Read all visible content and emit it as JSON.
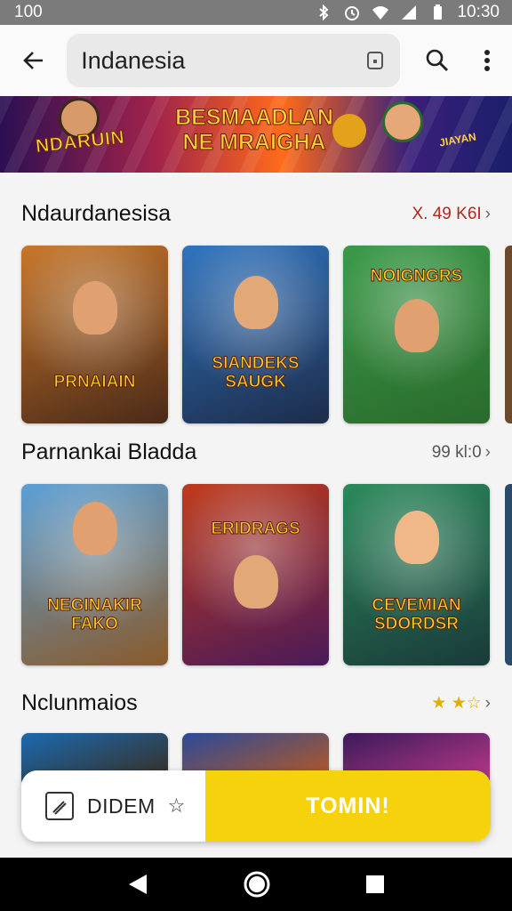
{
  "status_bar": {
    "time_left": "100",
    "time_right": "10:30"
  },
  "app_bar": {
    "search_value": "Indanesia"
  },
  "banner": {
    "left_title": "NDARUIN",
    "center_title": "BESMAADLAN NE MRAIGHA",
    "right_title": "JIAYAN"
  },
  "sections": [
    {
      "title": "Ndaurdanesisa",
      "meta": "X. 49 K6I",
      "meta_color": "#b3261e",
      "cards": [
        {
          "title": "PRNAIAIN",
          "colors": [
            "#c8772a",
            "#4a2a18"
          ]
        },
        {
          "title": "SIANDEKS SAUGK",
          "colors": [
            "#2f74c0",
            "#1d2c4a"
          ]
        },
        {
          "title": "NOIGNGRS",
          "colors": [
            "#3a9a48",
            "#2a6a2c"
          ]
        }
      ]
    },
    {
      "title": "Parnankai Bladda",
      "meta": "99 kl:0",
      "meta_color": "#555555",
      "cards": [
        {
          "title": "NEGINAKIR FAKO",
          "colors": [
            "#5aa0d8",
            "#8a5a2a"
          ]
        },
        {
          "title": "ERIDRAGS",
          "colors": [
            "#c03a1a",
            "#4a1a5a"
          ]
        },
        {
          "title": "CEVEMIAN SDORDSR",
          "colors": [
            "#2a8a5a",
            "#1a3a3a"
          ]
        }
      ]
    },
    {
      "title": "Nclunmaios",
      "meta": "★ ★☆",
      "meta_color": "#e0b000",
      "cards": [
        {
          "title": "",
          "colors": [
            "#1a6ab0",
            "#3a2a1a"
          ]
        },
        {
          "title": "",
          "colors": [
            "#2a4a9a",
            "#c05a1a"
          ]
        },
        {
          "title": "",
          "colors": [
            "#3a1a5a",
            "#c03a8a"
          ]
        }
      ]
    }
  ],
  "action_bar": {
    "left_label": "DIDEM",
    "right_label": "TOMIN!"
  },
  "colors": {
    "accent": "#f5d20c",
    "status_bar": "#7b7b7b"
  }
}
